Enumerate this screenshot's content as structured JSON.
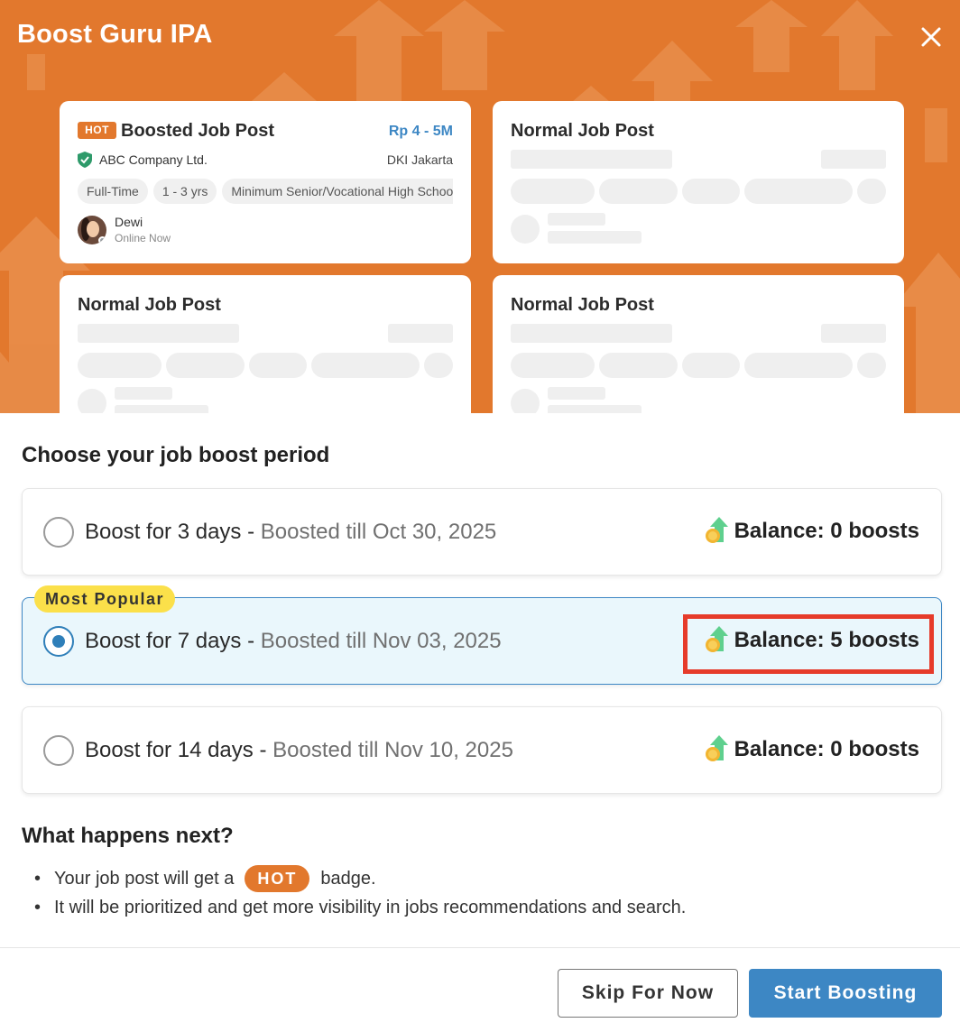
{
  "dialog": {
    "title": "Boost Guru IPA"
  },
  "preview": {
    "featured": {
      "hot_tag": "HOT",
      "title": "Boosted Job Post",
      "salary": "Rp 4 - 5M",
      "company": "ABC Company Ltd.",
      "location": "DKI Jakarta",
      "tags": [
        "Full-Time",
        "1 - 3 yrs",
        "Minimum Senior/Vocational High School"
      ],
      "recruiter_name": "Dewi",
      "recruiter_status": "Online Now"
    },
    "normal_cards": [
      {
        "title": "Normal Job Post"
      },
      {
        "title": "Normal Job Post"
      },
      {
        "title": "Normal Job Post"
      }
    ]
  },
  "period": {
    "heading": "Choose your job boost period",
    "popular_label": "Most Popular",
    "options": [
      {
        "main": "Boost for 3 days - ",
        "sub": "Boosted till Oct 30, 2025",
        "balance": "Balance: 0 boosts",
        "selected": false
      },
      {
        "main": "Boost for 7 days - ",
        "sub": "Boosted till Nov 03, 2025",
        "balance": "Balance: 5 boosts",
        "selected": true
      },
      {
        "main": "Boost for 14 days - ",
        "sub": "Boosted till Nov 10, 2025",
        "balance": "Balance: 0 boosts",
        "selected": false
      }
    ]
  },
  "next": {
    "heading": "What happens next?",
    "bullet1_before": "Your job post will get a",
    "bullet1_badge": "HOT",
    "bullet1_after": "badge.",
    "bullet2": "It will be prioritized and get more visibility in jobs recommendations and search."
  },
  "footer": {
    "skip_label": "Skip For Now",
    "start_label": "Start Boosting"
  },
  "colors": {
    "brand_orange": "#e2782d",
    "primary_blue": "#3d87c4",
    "highlight_red": "#e63b2a",
    "popular_yellow": "#fbe04a"
  },
  "icons": {
    "close": "close-icon",
    "verified": "shield-check-icon",
    "balance": "boost-coin-icon"
  }
}
